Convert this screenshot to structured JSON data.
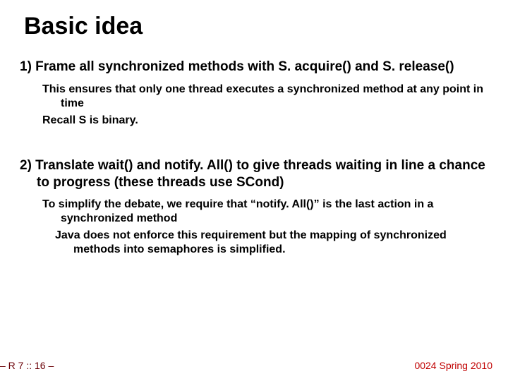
{
  "title": "Basic idea",
  "points": {
    "p1": {
      "text": "1) Frame all synchronized methods with S. acquire() and S. release()",
      "sub1": "This ensures that only one thread executes a synchronized method at any point in  time",
      "sub2": "Recall S  is binary."
    },
    "p2": {
      "text": "2) Translate wait() and notify. All() to give threads waiting in line a chance to progress (these threads use SCond)",
      "sub1": "To simplify the debate, we require that “notify. All()” is the last action in a synchronized method",
      "sub2": "Java does not enforce this requirement but the mapping of synchronized methods into semaphores is simplified."
    }
  },
  "footer": {
    "left": "– R 7 :: 16 –",
    "right": "0024 Spring 2010"
  }
}
